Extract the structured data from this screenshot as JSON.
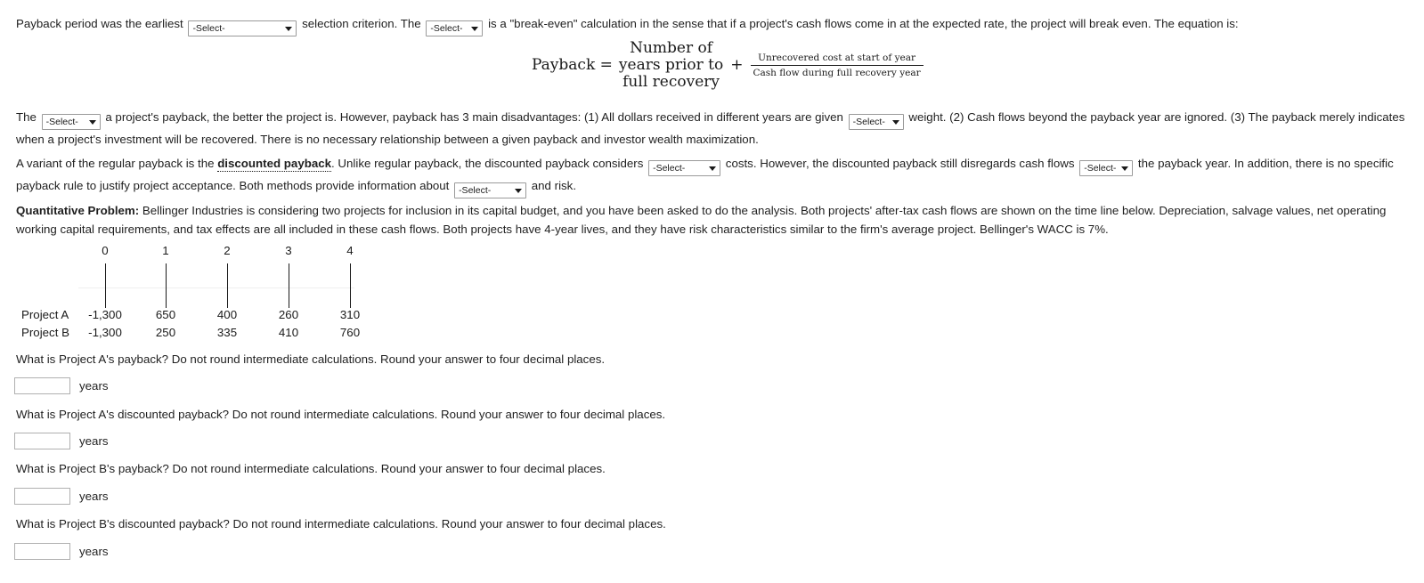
{
  "intro": {
    "seg1": "Payback period was the earliest",
    "select1": {
      "value": "-Select-",
      "name": "payback-criterion-select"
    },
    "seg2": "selection criterion. The",
    "select2": {
      "value": "-Select-",
      "name": "breakeven-term-select"
    },
    "seg3": "is a \"break-even\" calculation in the sense that if a project's cash flows come in at the expected rate, the project will break even. The equation is:"
  },
  "equation": {
    "lhs": "Payback =",
    "stack_line1": "Number of",
    "stack_line2": "years prior to",
    "stack_line3": "full recovery",
    "plus": "+",
    "numerator": "Unrecovered cost at start of year",
    "denominator": "Cash flow during full recovery year"
  },
  "para2": {
    "seg1": "The",
    "select1": {
      "value": "-Select-",
      "name": "shorter-longer-select"
    },
    "seg2": "a project's payback, the better the project is. However, payback has 3 main disadvantages: (1) All dollars received in different years are given",
    "select2": {
      "value": "-Select-",
      "name": "weight-select"
    },
    "seg3": "weight. (2) Cash flows beyond the payback year are ignored. (3) The payback merely indicates when a project's investment will be recovered. There is no necessary relationship between a given payback and investor wealth maximization."
  },
  "para3": {
    "seg1": "A variant of the regular payback is the",
    "emphasis": "discounted payback",
    "seg2": ". Unlike regular payback, the discounted payback considers",
    "select1": {
      "value": "-Select-",
      "name": "capital-costs-select"
    },
    "seg3": "costs. However, the discounted payback still disregards cash flows",
    "select2": {
      "value": "-Select-",
      "name": "beyond-before-select"
    },
    "seg4": "the payback year. In addition, there is no specific payback rule to justify project acceptance. Both methods provide information about",
    "select3": {
      "value": "-Select-",
      "name": "liquidity-select"
    },
    "seg5": "and risk."
  },
  "problem": {
    "label": "Quantitative Problem:",
    "text": " Bellinger Industries is considering two projects for inclusion in its capital budget, and you have been asked to do the analysis. Both projects' after-tax cash flows are shown on the time line below. Depreciation, salvage values, net operating working capital requirements, and tax effects are all included in these cash flows. Both projects have 4-year lives, and they have risk characteristics similar to the firm's average project. Bellinger's WACC is 7%."
  },
  "timeline": {
    "periods": [
      "0",
      "1",
      "2",
      "3",
      "4"
    ],
    "rows": [
      {
        "label": "Project A",
        "values": [
          "-1,300",
          "650",
          "400",
          "260",
          "310"
        ]
      },
      {
        "label": "Project B",
        "values": [
          "-1,300",
          "250",
          "335",
          "410",
          "760"
        ]
      }
    ]
  },
  "questions": [
    {
      "text": "What is Project A's payback? Do not round intermediate calculations. Round your answer to four decimal places.",
      "value": "",
      "unit": "years"
    },
    {
      "text": "What is Project A's discounted payback? Do not round intermediate calculations. Round your answer to four decimal places.",
      "value": "",
      "unit": "years"
    },
    {
      "text": "What is Project B's payback? Do not round intermediate calculations. Round your answer to four decimal places.",
      "value": "",
      "unit": "years"
    },
    {
      "text": "What is Project B's discounted payback? Do not round intermediate calculations. Round your answer to four decimal places.",
      "value": "",
      "unit": "years"
    }
  ]
}
